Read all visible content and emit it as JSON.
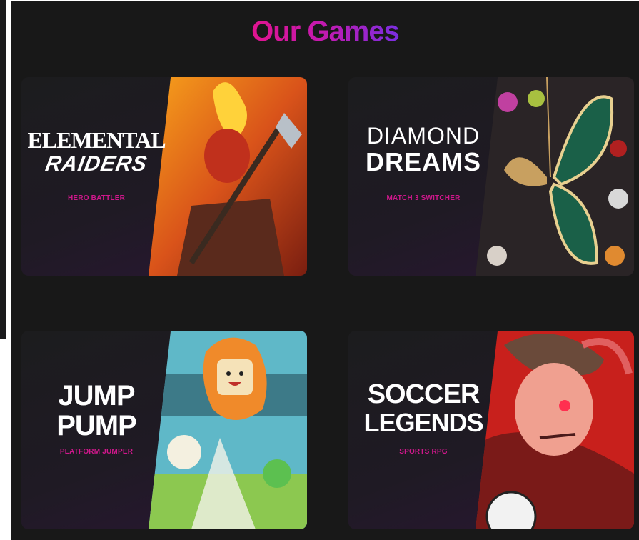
{
  "page": {
    "title": "Our Games"
  },
  "games": [
    {
      "name_line1": "ELEMENTAL",
      "name_line2": "RAIDERS",
      "genre": "HERO BATTLER",
      "art": "fire-elf-warrior-illustration"
    },
    {
      "name_line1": "DIAMOND",
      "name_line2": "DREAMS",
      "genre": "MATCH 3 SWITCHER",
      "art": "jeweled-butterfly-illustration"
    },
    {
      "name_line1": "JUMP",
      "name_line2": "PUMP",
      "genre": "PLATFORM JUMPER",
      "art": "jumping-cartoon-characters-illustration"
    },
    {
      "name_line1": "SOCCER",
      "name_line2": "LEGENDS",
      "genre": "SPORTS RPG",
      "art": "anime-soccer-player-illustration"
    }
  ],
  "colors": {
    "accent_pink": "#d0178c",
    "title_gradient_start": "#e0148f",
    "title_gradient_end": "#7a2ee0",
    "background": "#181818"
  }
}
